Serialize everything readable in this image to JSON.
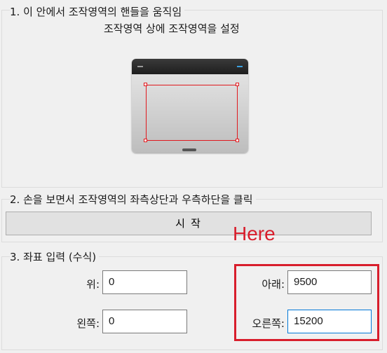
{
  "section1": {
    "title": "1. 이 안에서 조작영역의 핸들을 움직임",
    "subtitle": "조작영역 상에 조작영역을 설정"
  },
  "section2": {
    "title": "2. 손을 보면서 조작영역의 좌측상단과 우측하단을 클릭",
    "start_button": "시 작"
  },
  "annotation": {
    "text": "Here",
    "color": "#d81e2c"
  },
  "section3": {
    "title": "3. 좌표 입력 (수식)",
    "fields": {
      "top": {
        "label": "위:",
        "value": "0"
      },
      "left": {
        "label": "왼쪽:",
        "value": "0"
      },
      "bottom": {
        "label": "아래:",
        "value": "9500"
      },
      "right": {
        "label": "오른쪽:",
        "value": "15200"
      }
    }
  },
  "colors": {
    "handle_red": "#e0191e",
    "highlight_red": "#d81e2c",
    "focus_blue": "#0078d7"
  }
}
